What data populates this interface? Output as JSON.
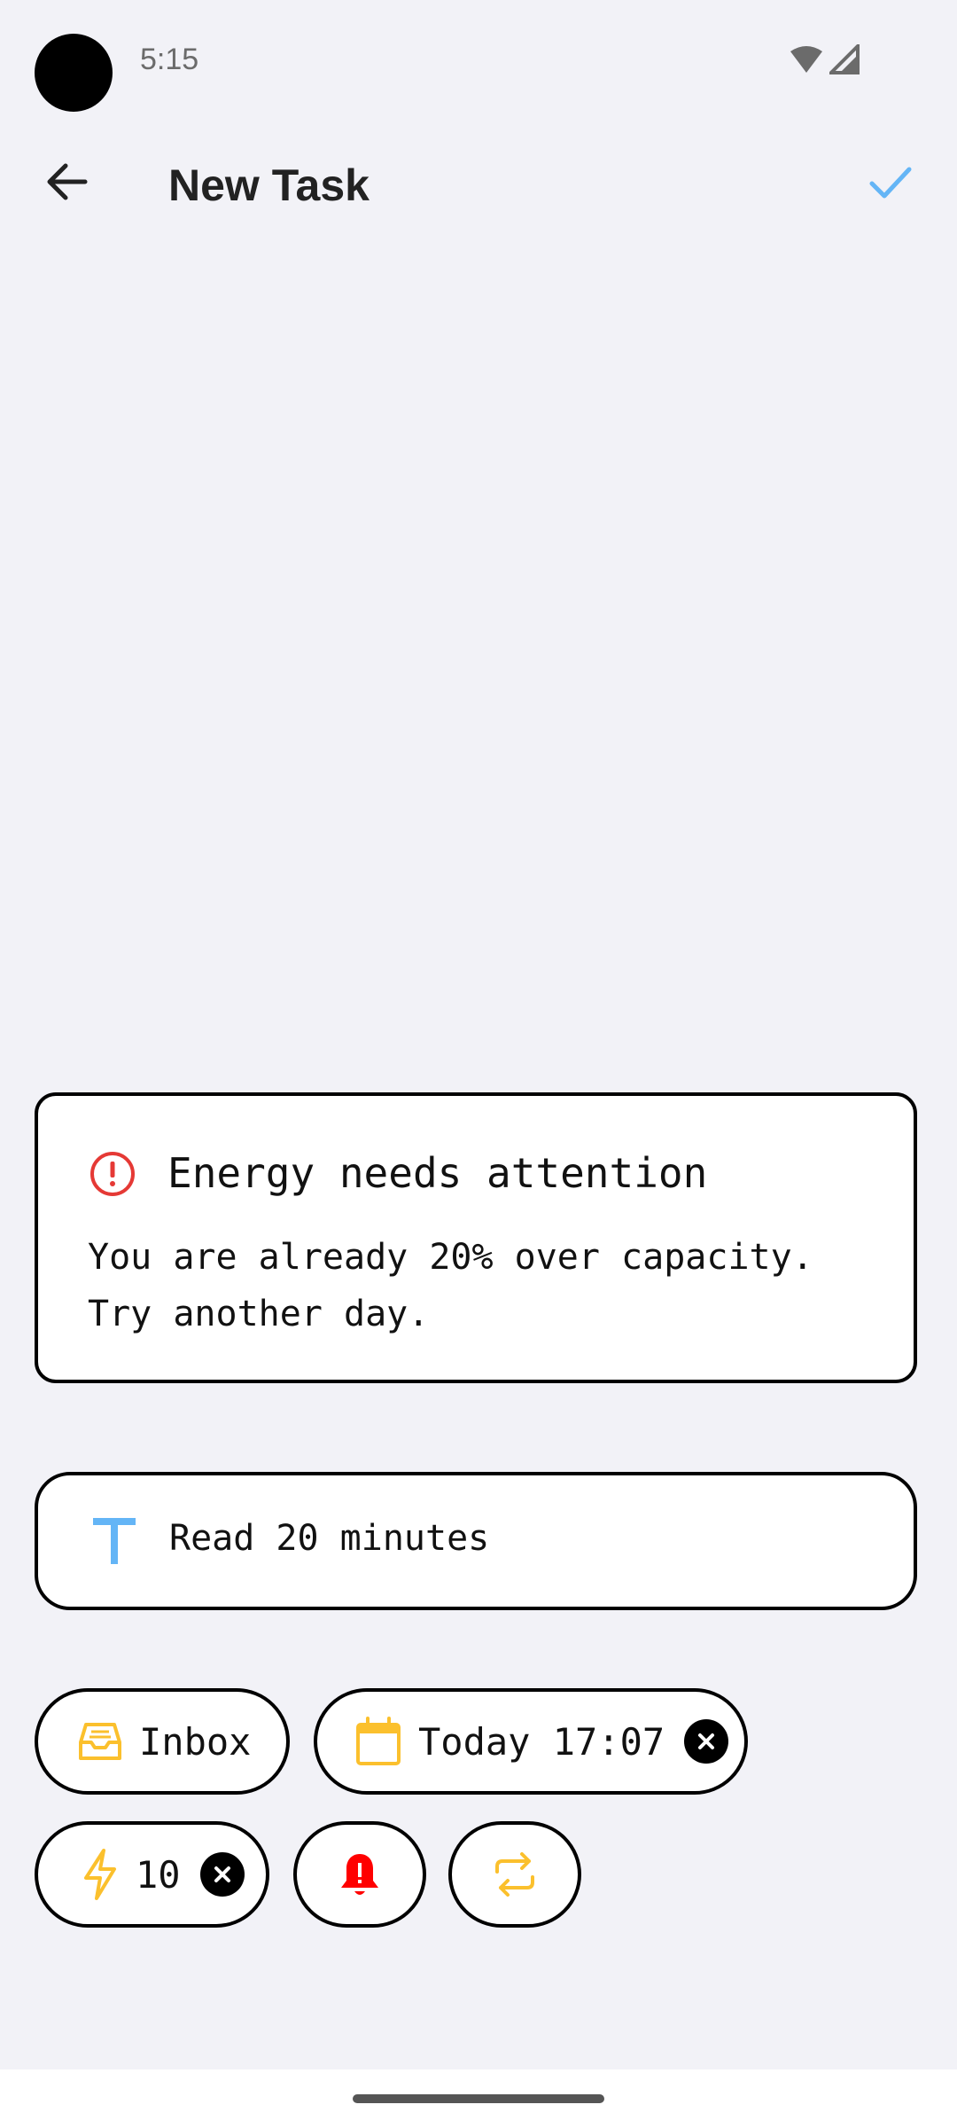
{
  "status_bar": {
    "time": "5:15"
  },
  "app_bar": {
    "title": "New Task",
    "back_icon": "arrow-left-icon",
    "confirm_icon": "check-icon",
    "accent_color": "#64b5f6"
  },
  "warning": {
    "icon": "alert-circle-icon",
    "icon_color": "#e53935",
    "title": "Energy needs attention",
    "body": "You are already 20% over capacity.\nTry another day."
  },
  "task": {
    "icon": "text-type-icon",
    "icon_color": "#64b5f6",
    "value": "Read 20 minutes"
  },
  "chips": {
    "inbox": {
      "label": "Inbox",
      "icon": "inbox-tray-icon",
      "icon_color": "#fbc02d"
    },
    "date": {
      "label": "Today 17:07",
      "icon": "calendar-icon",
      "icon_color": "#fbc02d"
    },
    "energy": {
      "label": "10",
      "icon": "lightning-icon",
      "icon_color": "#fbc02d"
    },
    "reminder": {
      "icon": "bell-alert-icon",
      "icon_color": "#ff0000"
    },
    "repeat": {
      "icon": "repeat-icon",
      "icon_color": "#fbc02d"
    }
  }
}
